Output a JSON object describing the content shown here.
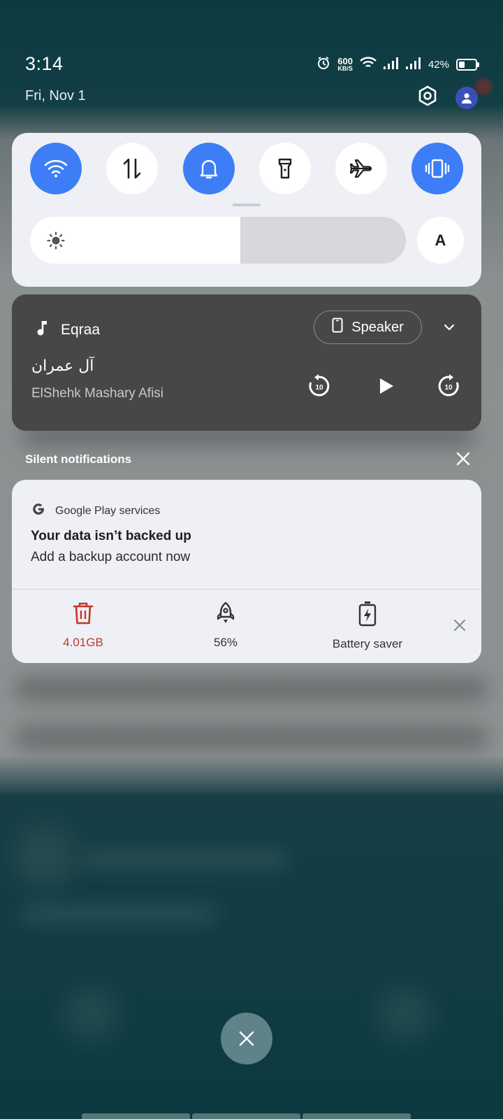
{
  "status_bar": {
    "time": "3:14",
    "date": "Fri, Nov 1",
    "net_speed_value": "600",
    "net_speed_unit": "KB/S",
    "battery": "42%",
    "icons": [
      "alarm-icon",
      "wifi-icon",
      "signal-icon",
      "signal-icon",
      "battery-icon"
    ]
  },
  "quick_settings": {
    "toggles": [
      {
        "name": "wifi",
        "icon": "wifi-icon",
        "on": true
      },
      {
        "name": "mobile-data",
        "icon": "data-arrows-icon",
        "on": false
      },
      {
        "name": "sound",
        "icon": "bell-icon",
        "on": true
      },
      {
        "name": "flashlight",
        "icon": "flashlight-icon",
        "on": false
      },
      {
        "name": "airplane-mode",
        "icon": "airplane-icon",
        "on": false
      },
      {
        "name": "vibrate",
        "icon": "vibrate-icon",
        "on": true
      }
    ],
    "brightness_fraction": 0.56,
    "auto_label": "A"
  },
  "media": {
    "app_name": "Eqraa",
    "output_label": "Speaker",
    "title": "آل عمران",
    "artist": "ElShehk Mashary Afisi",
    "rewind_label": "10",
    "forward_label": "10"
  },
  "silent_notifications": {
    "header": "Silent notifications"
  },
  "notification": {
    "app_name": "Google Play services",
    "app_icon_letter": "G",
    "title": "Your data isn’t backed up",
    "text": "Add a backup account now",
    "actions": [
      {
        "label": "4.01GB",
        "icon": "trash-icon",
        "color": "#c0392b"
      },
      {
        "label": "56%",
        "icon": "rocket-icon",
        "color": "#333333"
      },
      {
        "label": "Battery saver",
        "icon": "battery-saver-icon",
        "color": "#333333"
      }
    ]
  },
  "colors": {
    "accent": "#3d7ef7",
    "panel": "#eef0f5",
    "media_card": "#474747",
    "storage_red": "#c0392b"
  }
}
